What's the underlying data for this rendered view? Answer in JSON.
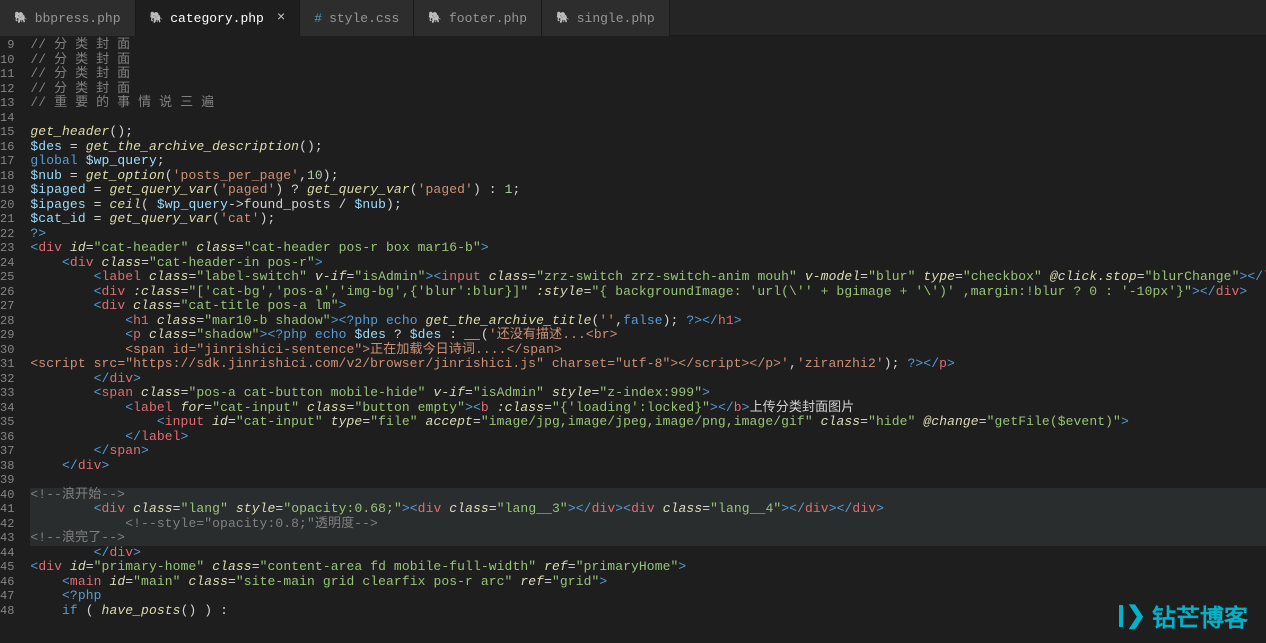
{
  "tabs": [
    {
      "icon": "php",
      "label": "bbpress.php",
      "active": false,
      "close": false
    },
    {
      "icon": "php",
      "label": "category.php",
      "active": true,
      "close": true
    },
    {
      "icon": "css",
      "label": "style.css",
      "active": false,
      "close": false
    },
    {
      "icon": "php",
      "label": "footer.php",
      "active": false,
      "close": false
    },
    {
      "icon": "php",
      "label": "single.php",
      "active": false,
      "close": false
    }
  ],
  "first_line": 9,
  "current_line": 40,
  "watermark": "钻芒博客",
  "code_lines": [
    {
      "n": 9,
      "t": "comment",
      "v": "// 分 类 封 面"
    },
    {
      "n": 10,
      "t": "comment",
      "v": "// 分 类 封 面"
    },
    {
      "n": 11,
      "t": "comment",
      "v": "// 分 类 封 面"
    },
    {
      "n": 12,
      "t": "comment",
      "v": "// 分 类 封 面"
    },
    {
      "n": 13,
      "t": "comment",
      "v": "// 重 要 的 事 情 说 三 遍"
    },
    {
      "n": 14,
      "t": "blank",
      "v": ""
    },
    {
      "n": 15,
      "t": "php",
      "html": "<span class='c-func'>get_header</span><span class='c-punc'>();</span>"
    },
    {
      "n": 16,
      "t": "php",
      "html": "<span class='c-var'>$des</span> <span class='c-punc'>=</span> <span class='c-func'>get_the_archive_description</span><span class='c-punc'>();</span>"
    },
    {
      "n": 17,
      "t": "php",
      "html": "<span class='c-phpk'>global</span> <span class='c-var'>$wp_query</span><span class='c-punc'>;</span>"
    },
    {
      "n": 18,
      "t": "php",
      "html": "<span class='c-var'>$nub</span> <span class='c-punc'>=</span> <span class='c-func'>get_option</span><span class='c-punc'>(</span><span class='c-str'>'posts_per_page'</span><span class='c-punc'>,</span><span class='c-num'>10</span><span class='c-punc'>);</span>"
    },
    {
      "n": 19,
      "t": "php",
      "html": "<span class='c-var'>$ipaged</span> <span class='c-punc'>=</span> <span class='c-func'>get_query_var</span><span class='c-punc'>(</span><span class='c-str'>'paged'</span><span class='c-punc'>) ?</span> <span class='c-func'>get_query_var</span><span class='c-punc'>(</span><span class='c-str'>'paged'</span><span class='c-punc'>) :</span> <span class='c-num'>1</span><span class='c-punc'>;</span>"
    },
    {
      "n": 20,
      "t": "php",
      "html": "<span class='c-var'>$ipages</span> <span class='c-punc'>=</span> <span class='c-func'>ceil</span><span class='c-punc'>(</span> <span class='c-var'>$wp_query</span><span class='c-punc'>-&gt;</span><span class='c-text'>found_posts</span> <span class='c-punc'>/</span> <span class='c-var'>$nub</span><span class='c-punc'>);</span>"
    },
    {
      "n": 21,
      "t": "php",
      "html": "<span class='c-var'>$cat_id</span> <span class='c-punc'>=</span> <span class='c-func'>get_query_var</span><span class='c-punc'>(</span><span class='c-str'>'cat'</span><span class='c-punc'>);</span>"
    },
    {
      "n": 22,
      "t": "php",
      "html": "<span class='c-phpk'>?&gt;</span>"
    },
    {
      "n": 23,
      "t": "html",
      "fold": true,
      "html": "<span class='c-tag'>&lt;</span><span class='c-tagname'>div</span> <span class='c-attr'>id</span><span class='c-eq'>=</span><span class='c-aval'>\"cat-header\"</span> <span class='c-attr'>class</span><span class='c-eq'>=</span><span class='c-aval'>\"cat-header pos-r box mar16-b\"</span><span class='c-tag'>&gt;</span>"
    },
    {
      "n": 24,
      "t": "html",
      "fold": true,
      "indent": 1,
      "html": "<span class='c-tag'>&lt;</span><span class='c-tagname'>div</span> <span class='c-attr'>class</span><span class='c-eq'>=</span><span class='c-aval'>\"cat-header-in pos-r\"</span><span class='c-tag'>&gt;</span>"
    },
    {
      "n": 25,
      "t": "html",
      "indent": 2,
      "html": "<span class='c-tag'>&lt;</span><span class='c-tagname'>label</span> <span class='c-attr'>class</span><span class='c-eq'>=</span><span class='c-aval'>\"label-switch\"</span> <span class='c-attr'>v-if</span><span class='c-eq'>=</span><span class='c-aval'>\"isAdmin\"</span><span class='c-tag'>&gt;&lt;</span><span class='c-tagname'>input</span> <span class='c-attr'>class</span><span class='c-eq'>=</span><span class='c-aval'>\"zrz-switch zrz-switch-anim mouh\"</span> <span class='c-attr'>v-model</span><span class='c-eq'>=</span><span class='c-aval'>\"blur\"</span> <span class='c-attr'>type</span><span class='c-eq'>=</span><span class='c-aval'>\"checkbox\"</span> <span class='c-attr'>@click.stop</span><span class='c-eq'>=</span><span class='c-aval'>\"blurChange\"</span><span class='c-tag'>&gt;&lt;/</span><span class='c-tagname'>label</span><span class='c-tag'>&gt;</span>"
    },
    {
      "n": 26,
      "t": "html",
      "indent": 2,
      "html": "<span class='c-tag'>&lt;</span><span class='c-tagname'>div</span> <span class='c-attr'>:class</span><span class='c-eq'>=</span><span class='c-aval'>\"['cat-bg','pos-a','img-bg',{'blur':blur}]\"</span> <span class='c-attr'>:style</span><span class='c-eq'>=</span><span class='c-aval'>\"{ backgroundImage: 'url(\\'' + bgimage + '\\')' ,margin:!blur ? 0 : '-10px'}\"</span><span class='c-tag'>&gt;&lt;/</span><span class='c-tagname'>div</span><span class='c-tag'>&gt;</span>"
    },
    {
      "n": 27,
      "t": "html",
      "fold": true,
      "indent": 2,
      "html": "<span class='c-tag'>&lt;</span><span class='c-tagname'>div</span> <span class='c-attr'>class</span><span class='c-eq'>=</span><span class='c-aval'>\"cat-title pos-a lm\"</span><span class='c-tag'>&gt;</span>"
    },
    {
      "n": 28,
      "t": "html",
      "indent": 3,
      "html": "<span class='c-tag'>&lt;</span><span class='c-tagname'>h1</span> <span class='c-attr'>class</span><span class='c-eq'>=</span><span class='c-aval'>\"mar10-b shadow\"</span><span class='c-tag'>&gt;</span><span class='c-phpk'>&lt;?php</span> <span class='c-phpk'>echo</span> <span class='c-func'>get_the_archive_title</span><span class='c-punc'>(</span><span class='c-str'>''</span><span class='c-punc'>,</span><span class='c-bool'>false</span><span class='c-punc'>);</span> <span class='c-phpk'>?&gt;</span><span class='c-tag'>&lt;/</span><span class='c-tagname'>h1</span><span class='c-tag'>&gt;</span>"
    },
    {
      "n": 29,
      "t": "html",
      "fold": true,
      "indent": 3,
      "html": "<span class='c-tag'>&lt;</span><span class='c-tagname'>p</span> <span class='c-attr'>class</span><span class='c-eq'>=</span><span class='c-aval'>\"shadow\"</span><span class='c-tag'>&gt;</span><span class='c-phpk'>&lt;?php</span> <span class='c-phpk'>echo</span> <span class='c-var'>$des</span> <span class='c-punc'>?</span> <span class='c-var'>$des</span> <span class='c-punc'>:</span> <span class='c-func'>__</span><span class='c-punc'>(</span><span class='c-str'>'还没有描述...&lt;br&gt;</span>"
    },
    {
      "n": 30,
      "t": "html",
      "indent": 3,
      "html": "<span class='c-str'>&lt;span id=\"jinrishici-sentence\"&gt;正在加载今日诗词....&lt;/span&gt;</span>"
    },
    {
      "n": 31,
      "t": "html",
      "html": "<span class='c-str'>&lt;script src=\"https://sdk.jinrishici.com/v2/browser/jinrishici.js\" charset=\"utf-8\"&gt;&lt;/script&gt;&lt;/p&gt;'</span><span class='c-punc'>,</span><span class='c-str'>'ziranzhi2'</span><span class='c-punc'>);</span> <span class='c-phpk'>?&gt;</span><span class='c-tag'>&lt;/</span><span class='c-tagname'>p</span><span class='c-tag'>&gt;</span>"
    },
    {
      "n": 32,
      "t": "html",
      "indent": 2,
      "html": "<span class='c-tag'>&lt;/</span><span class='c-tagname'>div</span><span class='c-tag'>&gt;</span>"
    },
    {
      "n": 33,
      "t": "html",
      "fold": true,
      "indent": 2,
      "html": "<span class='c-tag'>&lt;</span><span class='c-tagname'>span</span> <span class='c-attr'>class</span><span class='c-eq'>=</span><span class='c-aval'>\"pos-a cat-button mobile-hide\"</span> <span class='c-attr'>v-if</span><span class='c-eq'>=</span><span class='c-aval'>\"isAdmin\"</span> <span class='c-attr'>style</span><span class='c-eq'>=</span><span class='c-aval'>\"z-index:999\"</span><span class='c-tag'>&gt;</span>"
    },
    {
      "n": 34,
      "t": "html",
      "fold": true,
      "indent": 3,
      "html": "<span class='c-tag'>&lt;</span><span class='c-tagname'>label</span> <span class='c-attr'>for</span><span class='c-eq'>=</span><span class='c-aval'>\"cat-input\"</span> <span class='c-attr'>class</span><span class='c-eq'>=</span><span class='c-aval'>\"button empty\"</span><span class='c-tag'>&gt;&lt;</span><span class='c-tagname'>b</span> <span class='c-attr'>:class</span><span class='c-eq'>=</span><span class='c-aval'>\"{'loading':locked}\"</span><span class='c-tag'>&gt;&lt;/</span><span class='c-tagname'>b</span><span class='c-tag'>&gt;</span><span class='c-text'>上传分类封面图片</span>"
    },
    {
      "n": 35,
      "t": "html",
      "indent": 4,
      "html": "<span class='c-tag'>&lt;</span><span class='c-tagname'>input</span> <span class='c-attr'>id</span><span class='c-eq'>=</span><span class='c-aval'>\"cat-input\"</span> <span class='c-attr'>type</span><span class='c-eq'>=</span><span class='c-aval'>\"file\"</span> <span class='c-attr'>accept</span><span class='c-eq'>=</span><span class='c-aval'>\"image/jpg,image/jpeg,image/png,image/gif\"</span> <span class='c-attr'>class</span><span class='c-eq'>=</span><span class='c-aval'>\"hide\"</span> <span class='c-attr'>@change</span><span class='c-eq'>=</span><span class='c-aval'>\"getFile($event)\"</span><span class='c-tag'>&gt;</span>"
    },
    {
      "n": 36,
      "t": "html",
      "indent": 3,
      "html": "<span class='c-tag'>&lt;/</span><span class='c-tagname'>label</span><span class='c-tag'>&gt;</span>"
    },
    {
      "n": 37,
      "t": "html",
      "indent": 2,
      "html": "<span class='c-tag'>&lt;/</span><span class='c-tagname'>span</span><span class='c-tag'>&gt;</span>"
    },
    {
      "n": 38,
      "t": "html",
      "indent": 1,
      "html": "<span class='c-tag'>&lt;/</span><span class='c-tagname'>div</span><span class='c-tag'>&gt;</span>"
    },
    {
      "n": 39,
      "t": "blank",
      "v": ""
    },
    {
      "n": 40,
      "t": "ghost",
      "hl": true,
      "html": "<span class='c-comment'>&lt;!--浪开始--&gt;</span>"
    },
    {
      "n": 41,
      "t": "html",
      "hl": true,
      "indent": 2,
      "html": "<span class='c-tag'>&lt;</span><span class='c-tagname'>div</span> <span class='c-attr'>class</span><span class='c-eq'>=</span><span class='c-aval'>\"lang\"</span> <span class='c-attr'>style</span><span class='c-eq'>=</span><span class='c-aval'>\"opacity:0.68;\"</span><span class='c-tag'>&gt;&lt;</span><span class='c-tagname'>div</span> <span class='c-attr'>class</span><span class='c-eq'>=</span><span class='c-aval'>\"lang__3\"</span><span class='c-tag'>&gt;&lt;/</span><span class='c-tagname'>div</span><span class='c-tag'>&gt;&lt;</span><span class='c-tagname'>div</span> <span class='c-attr'>class</span><span class='c-eq'>=</span><span class='c-aval'>\"lang__4\"</span><span class='c-tag'>&gt;&lt;/</span><span class='c-tagname'>div</span><span class='c-tag'>&gt;&lt;/</span><span class='c-tagname'>div</span><span class='c-tag'>&gt;</span>"
    },
    {
      "n": 42,
      "t": "ghost",
      "hl": true,
      "indent": 3,
      "html": "<span class='c-comment'>&lt;!--style=\"opacity:0.8;\"透明度--&gt;</span>"
    },
    {
      "n": 43,
      "t": "ghost",
      "hl": true,
      "html": "<span class='c-comment'>&lt;!--浪完了--&gt;</span>"
    },
    {
      "n": 44,
      "t": "html",
      "indent": 2,
      "html": "<span class='c-tag'>&lt;/</span><span class='c-tagname'>div</span><span class='c-tag'>&gt;</span>"
    },
    {
      "n": 45,
      "t": "html",
      "fold": true,
      "html": "<span class='c-tag'>&lt;</span><span class='c-tagname'>div</span> <span class='c-attr'>id</span><span class='c-eq'>=</span><span class='c-aval'>\"primary-home\"</span> <span class='c-attr'>class</span><span class='c-eq'>=</span><span class='c-aval'>\"content-area fd mobile-full-width\"</span> <span class='c-attr'>ref</span><span class='c-eq'>=</span><span class='c-aval'>\"primaryHome\"</span><span class='c-tag'>&gt;</span>"
    },
    {
      "n": 46,
      "t": "html",
      "fold": true,
      "indent": 1,
      "html": "<span class='c-tag'>&lt;</span><span class='c-tagname'>main</span> <span class='c-attr'>id</span><span class='c-eq'>=</span><span class='c-aval'>\"main\"</span> <span class='c-attr'>class</span><span class='c-eq'>=</span><span class='c-aval'>\"site-main grid clearfix pos-r arc\"</span> <span class='c-attr'>ref</span><span class='c-eq'>=</span><span class='c-aval'>\"grid\"</span><span class='c-tag'>&gt;</span>"
    },
    {
      "n": 47,
      "t": "php",
      "indent": 1,
      "html": "<span class='c-phpk'>&lt;?php</span>"
    },
    {
      "n": 48,
      "t": "php",
      "indent": 1,
      "html": "<span class='c-phpk'>if</span> <span class='c-punc'>(</span> <span class='c-func'>have_posts</span><span class='c-punc'>() ) :</span>"
    }
  ]
}
